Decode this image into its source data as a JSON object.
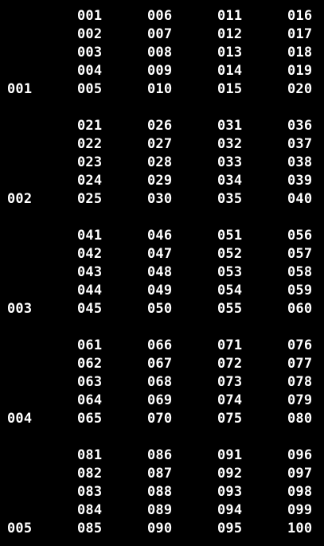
{
  "colors": {
    "background": "#000000",
    "text": "#ffffff"
  },
  "groups": [
    {
      "label": "001",
      "columns": [
        [
          "001",
          "002",
          "003",
          "004",
          "005"
        ],
        [
          "006",
          "007",
          "008",
          "009",
          "010"
        ],
        [
          "011",
          "012",
          "013",
          "014",
          "015"
        ],
        [
          "016",
          "017",
          "018",
          "019",
          "020"
        ]
      ]
    },
    {
      "label": "002",
      "columns": [
        [
          "021",
          "022",
          "023",
          "024",
          "025"
        ],
        [
          "026",
          "027",
          "028",
          "029",
          "030"
        ],
        [
          "031",
          "032",
          "033",
          "034",
          "035"
        ],
        [
          "036",
          "037",
          "038",
          "039",
          "040"
        ]
      ]
    },
    {
      "label": "003",
      "columns": [
        [
          "041",
          "042",
          "043",
          "044",
          "045"
        ],
        [
          "046",
          "047",
          "048",
          "049",
          "050"
        ],
        [
          "051",
          "052",
          "053",
          "054",
          "055"
        ],
        [
          "056",
          "057",
          "058",
          "059",
          "060"
        ]
      ]
    },
    {
      "label": "004",
      "columns": [
        [
          "061",
          "062",
          "063",
          "064",
          "065"
        ],
        [
          "066",
          "067",
          "068",
          "069",
          "070"
        ],
        [
          "071",
          "072",
          "073",
          "074",
          "075"
        ],
        [
          "076",
          "077",
          "078",
          "079",
          "080"
        ]
      ]
    },
    {
      "label": "005",
      "columns": [
        [
          "081",
          "082",
          "083",
          "084",
          "085"
        ],
        [
          "086",
          "087",
          "088",
          "089",
          "090"
        ],
        [
          "091",
          "092",
          "093",
          "094",
          "095"
        ],
        [
          "096",
          "097",
          "098",
          "099",
          "100"
        ]
      ]
    }
  ]
}
